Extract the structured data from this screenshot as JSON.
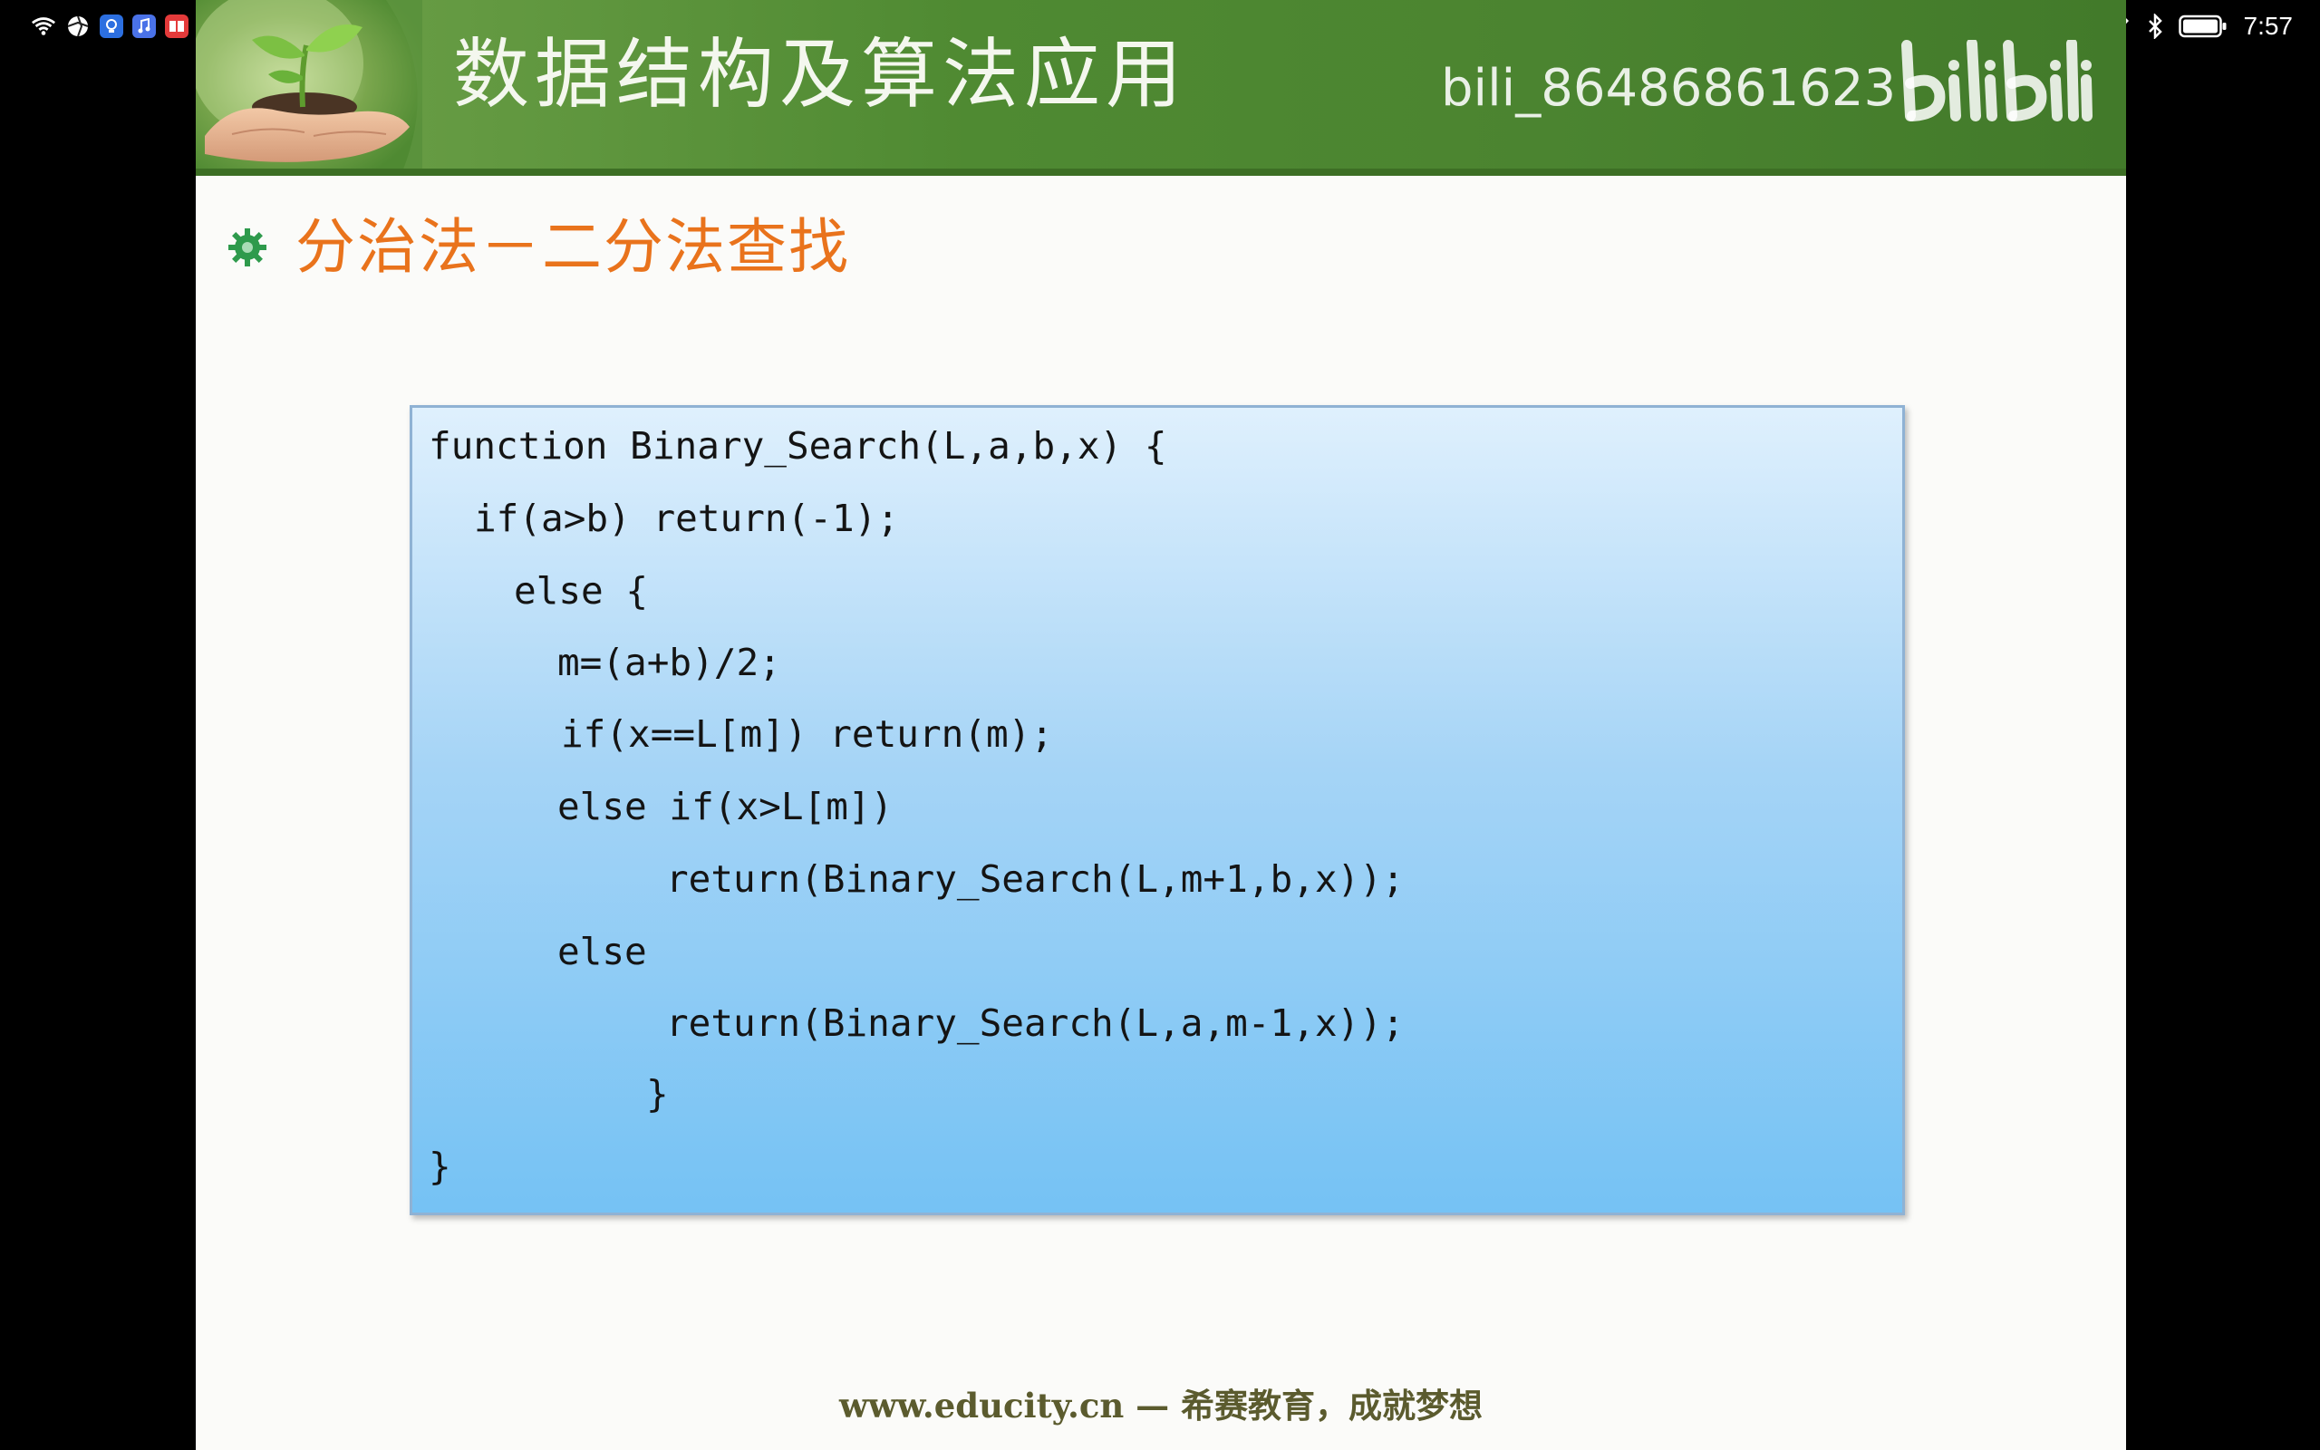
{
  "status_bar": {
    "time": "7:57",
    "left_icons": [
      "wifi-icon",
      "app-shutter-icon",
      "app-bulb-icon",
      "app-music-icon",
      "app-book-icon",
      "app-heart-icon"
    ],
    "right_icons": [
      "eye-icon",
      "pen-icon",
      "bluetooth-icon",
      "battery-icon"
    ]
  },
  "slide": {
    "header_title": "数据结构及算法应用",
    "watermark_user": "bili_86486861623",
    "watermark_logo": "bilibili",
    "section_title": "分治法－二分法查找",
    "code_lines": [
      "function Binary_Search(L,a,b,x) {",
      "if(a>b) return(-1);",
      "else {",
      "m=(a+b)/2;",
      "if(x==L[m]) return(m);",
      "else if(x>L[m])",
      "return(Binary_Search(L,m+1,b,x));",
      "else",
      "return(Binary_Search(L,a,m-1,x));",
      "}",
      "}"
    ],
    "footer": "www.educity.cn — 希赛教育，成就梦想"
  },
  "colors": {
    "header_green": "#4f8a32",
    "section_orange": "#e9731c",
    "code_box_top": "#dff0fd",
    "code_box_bottom": "#75c2f4",
    "bullet_green": "#2e9a4c"
  }
}
